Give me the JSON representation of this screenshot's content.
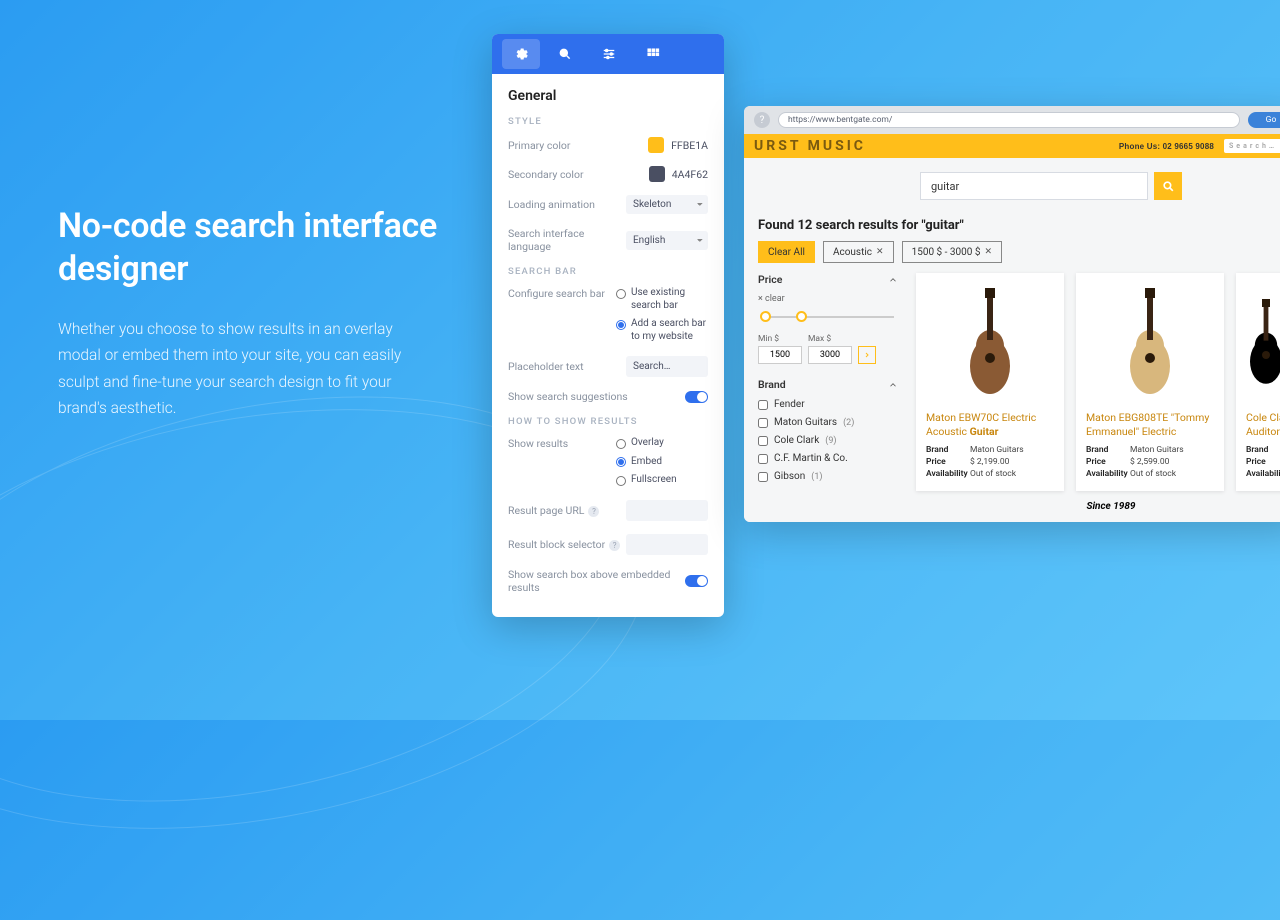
{
  "hero": {
    "title": "No-code search interface designer",
    "body": "Whether you choose to show results in an overlay modal or embed them into your site, you can easily sculpt and fine-tune your search design to fit your brand's aesthetic."
  },
  "designer": {
    "sections": {
      "general": "General",
      "style": "STYLE",
      "search_bar": "SEARCH BAR",
      "how_to_show": "HOW TO SHOW RESULTS"
    },
    "style": {
      "primary_label": "Primary color",
      "primary_value": "FFBE1A",
      "primary_hex": "#ffbe1a",
      "secondary_label": "Secondary color",
      "secondary_value": "4A4F62",
      "secondary_hex": "#4a4f62",
      "loading_label": "Loading animation",
      "loading_value": "Skeleton",
      "lang_label": "Search interface language",
      "lang_value": "English"
    },
    "search_bar": {
      "config_label": "Configure search bar",
      "opt_use_existing": "Use existing search bar",
      "opt_add": "Add a search bar to my website",
      "placeholder_label": "Placeholder text",
      "placeholder_value": "Search…",
      "suggestions_label": "Show search suggestions"
    },
    "results": {
      "show_label": "Show results",
      "overlay": "Overlay",
      "embed": "Embed",
      "fullscreen": "Fullscreen",
      "url_label": "Result page URL",
      "selector_label": "Result block selector",
      "above_label": "Show search box above embedded results"
    }
  },
  "browser": {
    "url": "https://www.bentgate.com/",
    "go": "Go",
    "site_name": "URST    MUSIC",
    "phone": "Phone Us: 02 9665 9088",
    "header_search_placeholder": "Search…",
    "query": "guitar",
    "results_count": "Found 12 search results for \"guitar\"",
    "chips": {
      "clear": "Clear All",
      "chip1": "Acoustic",
      "chip2": "1500 $ - 3000 $"
    },
    "price": {
      "heading": "Price",
      "clear": "× clear",
      "min_label": "Min $",
      "min_val": "1500",
      "max_label": "Max $",
      "max_val": "3000"
    },
    "brand": {
      "heading": "Brand",
      "items": [
        {
          "name": "Fender",
          "count": ""
        },
        {
          "name": "Maton Guitars",
          "count": "(2)"
        },
        {
          "name": "Cole Clark",
          "count": "(9)"
        },
        {
          "name": "C.F. Martin & Co.",
          "count": ""
        },
        {
          "name": "Gibson",
          "count": "(1)"
        }
      ]
    },
    "products": [
      {
        "title_a": "Maton EBW70C Electric Acoustic ",
        "title_b": "Guitar",
        "brand": "Maton Guitars",
        "price": "$ 2,199.00",
        "avail": "Out of stock",
        "color": "#8a5a34"
      },
      {
        "title_a": "Maton EBG808TE \"Tommy Emmanuel\" Electric",
        "title_b": "",
        "brand": "Maton Guitars",
        "price": "$ 2,599.00",
        "avail": "Out of stock",
        "color": "#d8b77d"
      },
      {
        "title_a": "Cole Cla",
        "title_b": "",
        "brand": "",
        "price": "",
        "avail": "",
        "title_c": "Auditoriu"
      }
    ],
    "spec_labels": {
      "brand": "Brand",
      "price": "Price",
      "avail": "Availability"
    },
    "since": "Since 1989"
  },
  "chart_data": null
}
